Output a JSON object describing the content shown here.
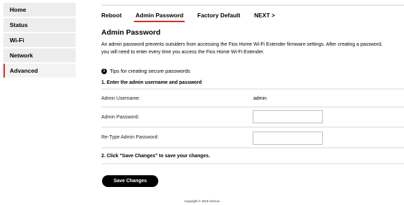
{
  "sidebar": {
    "items": [
      {
        "label": "Home"
      },
      {
        "label": "Status"
      },
      {
        "label": "Wi-Fi"
      },
      {
        "label": "Network"
      },
      {
        "label": "Advanced"
      }
    ]
  },
  "tabs": [
    {
      "label": "Reboot"
    },
    {
      "label": "Admin Password"
    },
    {
      "label": "Factory Default"
    },
    {
      "label": "NEXT >"
    }
  ],
  "main": {
    "title": "Admin Password",
    "description_line1": "An admin password prevents outsiders from accessing the Fios Home Wi-Fi Extender firmware settings. After creating a password,",
    "description_line2": "you will need to enter every time you access the Fios Home Wi-Fi Extender.",
    "tips_label": "Tips for creating secure passwords",
    "step1": "1. Enter the admin username and password",
    "username_label": "Admin Username:",
    "username_value": "admin",
    "password_label": "Admin Password:",
    "password_value": "",
    "retype_label": "Re-Type Admin Password:",
    "retype_value": "",
    "step2": "2. Click \"Save Changes\" to save your changes.",
    "save_label": "Save Changes"
  },
  "footer": {
    "copyright": "Copyright © 2019 Verizon"
  },
  "colors": {
    "accent": "#d52b1e",
    "nav_bg": "#ededed",
    "button_bg": "#000000"
  }
}
